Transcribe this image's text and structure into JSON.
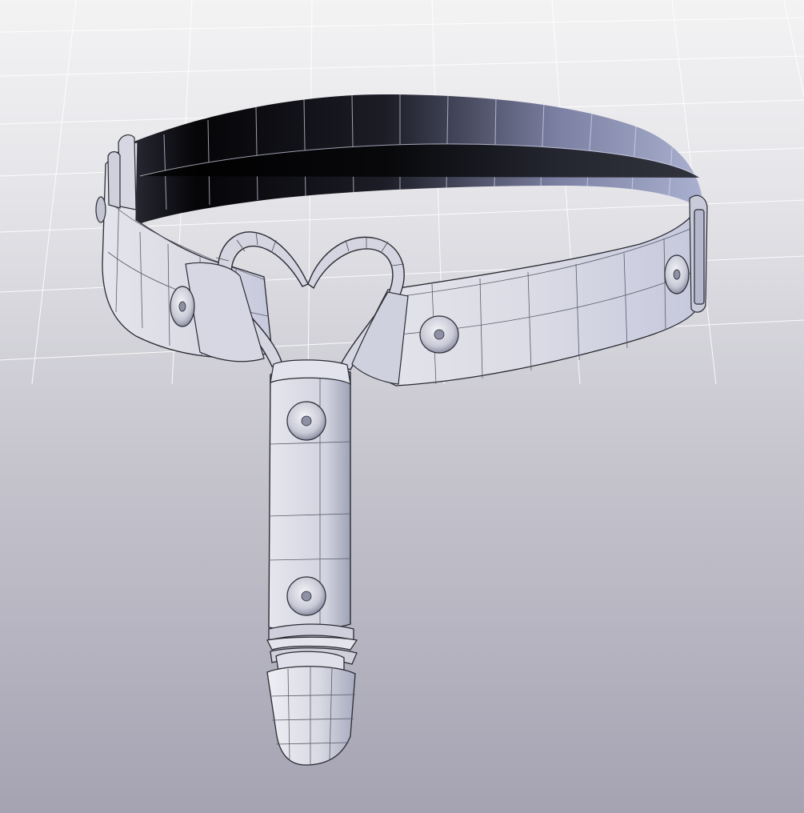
{
  "viewport": {
    "background_top": "#f3f3f4",
    "background_bottom": "#a5a3b2",
    "grid_color": "#ffffff",
    "mesh_color": "#e8e9f3",
    "wire_color": "#2a2b33",
    "strap_outer_color": "#eaeaf2",
    "strap_inner_dark": "#050507",
    "strap_inner_light": "#aab0cf"
  },
  "model": {
    "parts": [
      "collar-band",
      "heart-ring",
      "drop-strap",
      "garter-clip",
      "rivets"
    ],
    "rivet_count": 5
  }
}
